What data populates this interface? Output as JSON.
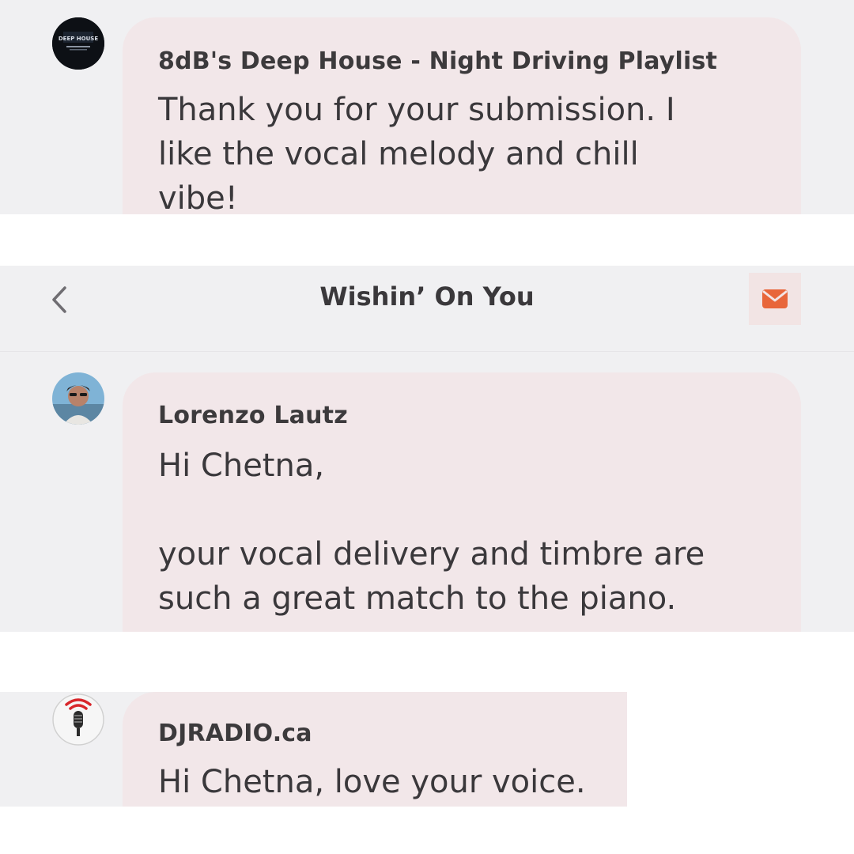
{
  "conversations": [
    {
      "sender": "8dB's Deep House - Night Driving Playlist",
      "avatar_icon": "deep-house-logo-icon",
      "avatar_text": "DEEP HOUSE",
      "message": "Thank you for your submission. I\nlike the vocal melody and chill\nvibe!"
    },
    {
      "sender": "Lorenzo Lautz",
      "avatar_icon": "user-photo-avatar",
      "message": "Hi Chetna,\n\nyour vocal delivery and timbre are\nsuch a great match to the piano."
    },
    {
      "sender": "DJRADIO.ca",
      "avatar_icon": "microphone-radio-icon",
      "message": "Hi Chetna, love your voice."
    }
  ],
  "header": {
    "title": "Wishin’ On You",
    "back_icon": "chevron-left-icon",
    "mail_icon": "envelope-icon"
  },
  "colors": {
    "accent": "#e8663a",
    "bubble": "#f2e7e9",
    "background": "#f0f0f2"
  }
}
